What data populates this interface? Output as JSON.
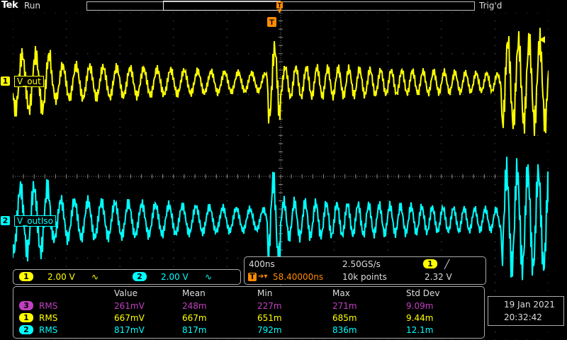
{
  "header": {
    "brand": "Tek",
    "run_state": "Run",
    "trigger_status": "Trig'd",
    "trigger_marker": "T"
  },
  "channels": [
    {
      "num": "1",
      "label": "V_out",
      "scale": "2.00 V",
      "coupling": "∿",
      "color": "#ffff00"
    },
    {
      "num": "2",
      "label": "V_outIso",
      "scale": "2.00 V",
      "coupling": "∿",
      "color": "#00ffff"
    }
  ],
  "timebase": {
    "time_div": "400ns",
    "sample_rate": "2.50GS/s",
    "trig_pos_prefix": "T",
    "trig_pos_arrow": "➔▾",
    "trig_pos": "58.40000ns",
    "record_length": "10k points",
    "trig_src": "1",
    "trig_slope": "╱",
    "trig_level": "2.32 V"
  },
  "measurements": {
    "headers": [
      "Value",
      "Mean",
      "Min",
      "Max",
      "Std Dev"
    ],
    "rows": [
      {
        "ch": "3",
        "type": "RMS",
        "value": "261mV",
        "mean": "248m",
        "min": "227m",
        "max": "271m",
        "std": "9.09m",
        "color": "#c040c0"
      },
      {
        "ch": "1",
        "type": "RMS",
        "value": "667mV",
        "mean": "667m",
        "min": "651m",
        "max": "685m",
        "std": "9.44m",
        "color": "#ffff00"
      },
      {
        "ch": "2",
        "type": "RMS",
        "value": "817mV",
        "mean": "817m",
        "min": "792m",
        "max": "836m",
        "std": "12.1m",
        "color": "#00ffff"
      }
    ]
  },
  "datetime": {
    "date": "19 Jan  2021",
    "time": "20:32:42"
  }
}
